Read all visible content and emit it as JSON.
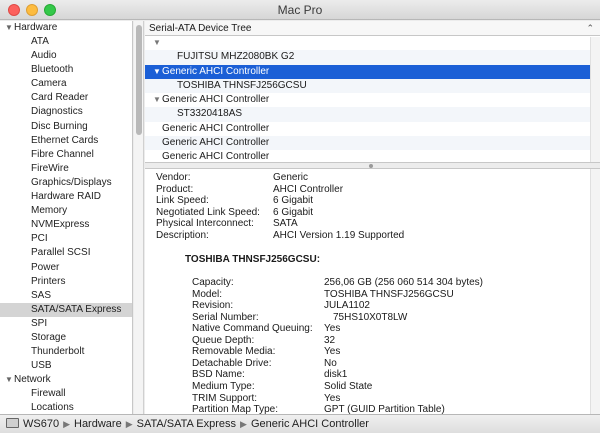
{
  "window": {
    "title": "Mac Pro"
  },
  "sidebar": {
    "hardware_header": "Hardware",
    "hardware_items": [
      "ATA",
      "Audio",
      "Bluetooth",
      "Camera",
      "Card Reader",
      "Diagnostics",
      "Disc Burning",
      "Ethernet Cards",
      "Fibre Channel",
      "FireWire",
      "Graphics/Displays",
      "Hardware RAID",
      "Memory",
      "NVMExpress",
      "PCI",
      "Parallel SCSI",
      "Power",
      "Printers",
      "SAS",
      "SATA/SATA Express",
      "SPI",
      "Storage",
      "Thunderbolt",
      "USB"
    ],
    "selected": "SATA/SATA Express",
    "network_header": "Network",
    "network_items": [
      "Firewall",
      "Locations"
    ]
  },
  "tree": {
    "header": "Serial-ATA Device Tree",
    "rows": [
      {
        "label": "",
        "expander": true,
        "child": false,
        "selected": false
      },
      {
        "label": "FUJITSU MHZ2080BK G2",
        "expander": false,
        "child": true,
        "selected": false
      },
      {
        "label": "Generic AHCI Controller",
        "expander": true,
        "child": false,
        "selected": true
      },
      {
        "label": "TOSHIBA THNSFJ256GCSU",
        "expander": false,
        "child": true,
        "selected": false
      },
      {
        "label": "Generic AHCI Controller",
        "expander": true,
        "child": false,
        "selected": false
      },
      {
        "label": "ST3320418AS",
        "expander": false,
        "child": true,
        "selected": false
      },
      {
        "label": "Generic AHCI Controller",
        "expander": false,
        "child": false,
        "selected": false
      },
      {
        "label": "Generic AHCI Controller",
        "expander": false,
        "child": false,
        "selected": false
      },
      {
        "label": "Generic AHCI Controller",
        "expander": false,
        "child": false,
        "selected": false
      }
    ]
  },
  "controller": [
    {
      "key": "Vendor:",
      "value": "Generic"
    },
    {
      "key": "Product:",
      "value": "AHCI Controller"
    },
    {
      "key": "Link Speed:",
      "value": "6 Gigabit"
    },
    {
      "key": "Negotiated Link Speed:",
      "value": "6 Gigabit"
    },
    {
      "key": "Physical Interconnect:",
      "value": "SATA"
    },
    {
      "key": "Description:",
      "value": "AHCI Version 1.19 Supported"
    }
  ],
  "device": {
    "title": "TOSHIBA THNSFJ256GCSU:",
    "props": [
      {
        "key": "Capacity:",
        "value": "256,06 GB (256 060 514 304 bytes)"
      },
      {
        "key": "Model:",
        "value": "TOSHIBA THNSFJ256GCSU"
      },
      {
        "key": "Revision:",
        "value": "JULA1102"
      },
      {
        "key": "Serial Number:",
        "value": "75HS10X0T8LW"
      },
      {
        "key": "Native Command Queuing:",
        "value": "Yes"
      },
      {
        "key": "Queue Depth:",
        "value": "32"
      },
      {
        "key": "Removable Media:",
        "value": "Yes"
      },
      {
        "key": "Detachable Drive:",
        "value": "No"
      },
      {
        "key": "BSD Name:",
        "value": "disk1"
      },
      {
        "key": "Medium Type:",
        "value": "Solid State"
      },
      {
        "key": "TRIM Support:",
        "value": "Yes"
      },
      {
        "key": "Partition Map Type:",
        "value": "GPT (GUID Partition Table)"
      }
    ]
  },
  "pathbar": [
    "WS670",
    "Hardware",
    "SATA/SATA Express",
    "Generic AHCI Controller"
  ],
  "icons": {
    "computer": "computer-icon",
    "disclosure": "disclosure-triangle-icon",
    "chevron": "chevron-up-icon"
  }
}
